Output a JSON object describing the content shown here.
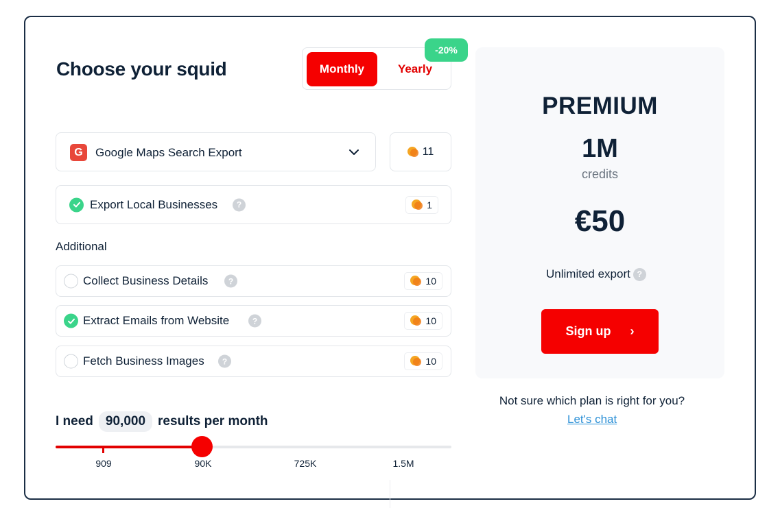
{
  "header": {
    "title": "Choose your squid"
  },
  "billing_toggle": {
    "monthly_label": "Monthly",
    "yearly_label": "Yearly",
    "discount_badge": "-20%",
    "selected": "Monthly"
  },
  "product": {
    "logo_letter": "G",
    "selected": "Google Maps Search Export",
    "total_credits": "11"
  },
  "base_option": {
    "label": "Export Local Businesses",
    "help": "?",
    "credits": "1",
    "checked": true
  },
  "additional": {
    "heading": "Additional",
    "options": [
      {
        "label": "Collect Business Details",
        "help": "?",
        "credits": "10",
        "checked": false
      },
      {
        "label": "Extract Emails from Website",
        "help": "?",
        "credits": "10",
        "checked": true
      },
      {
        "label": "Fetch Business Images",
        "help": "?",
        "credits": "10",
        "checked": false
      }
    ]
  },
  "volume": {
    "prefix": "I need",
    "value": "90,000",
    "suffix": "results per month",
    "slider_fraction": 0.37,
    "ticks": [
      "909",
      "90K",
      "725K",
      "1.5M"
    ]
  },
  "plan": {
    "name": "PREMIUM",
    "credits": "1M",
    "credits_label": "credits",
    "price": "€50",
    "export_label": "Unlimited export",
    "help": "?",
    "signup_label": "Sign up",
    "signup_arrow": "›"
  },
  "help_block": {
    "question": "Not sure which plan is right for you?",
    "link": "Let's chat"
  },
  "colors": {
    "accent": "#f50000",
    "success": "#3ad48a",
    "text": "#0f2136",
    "link": "#2a8fd6"
  }
}
